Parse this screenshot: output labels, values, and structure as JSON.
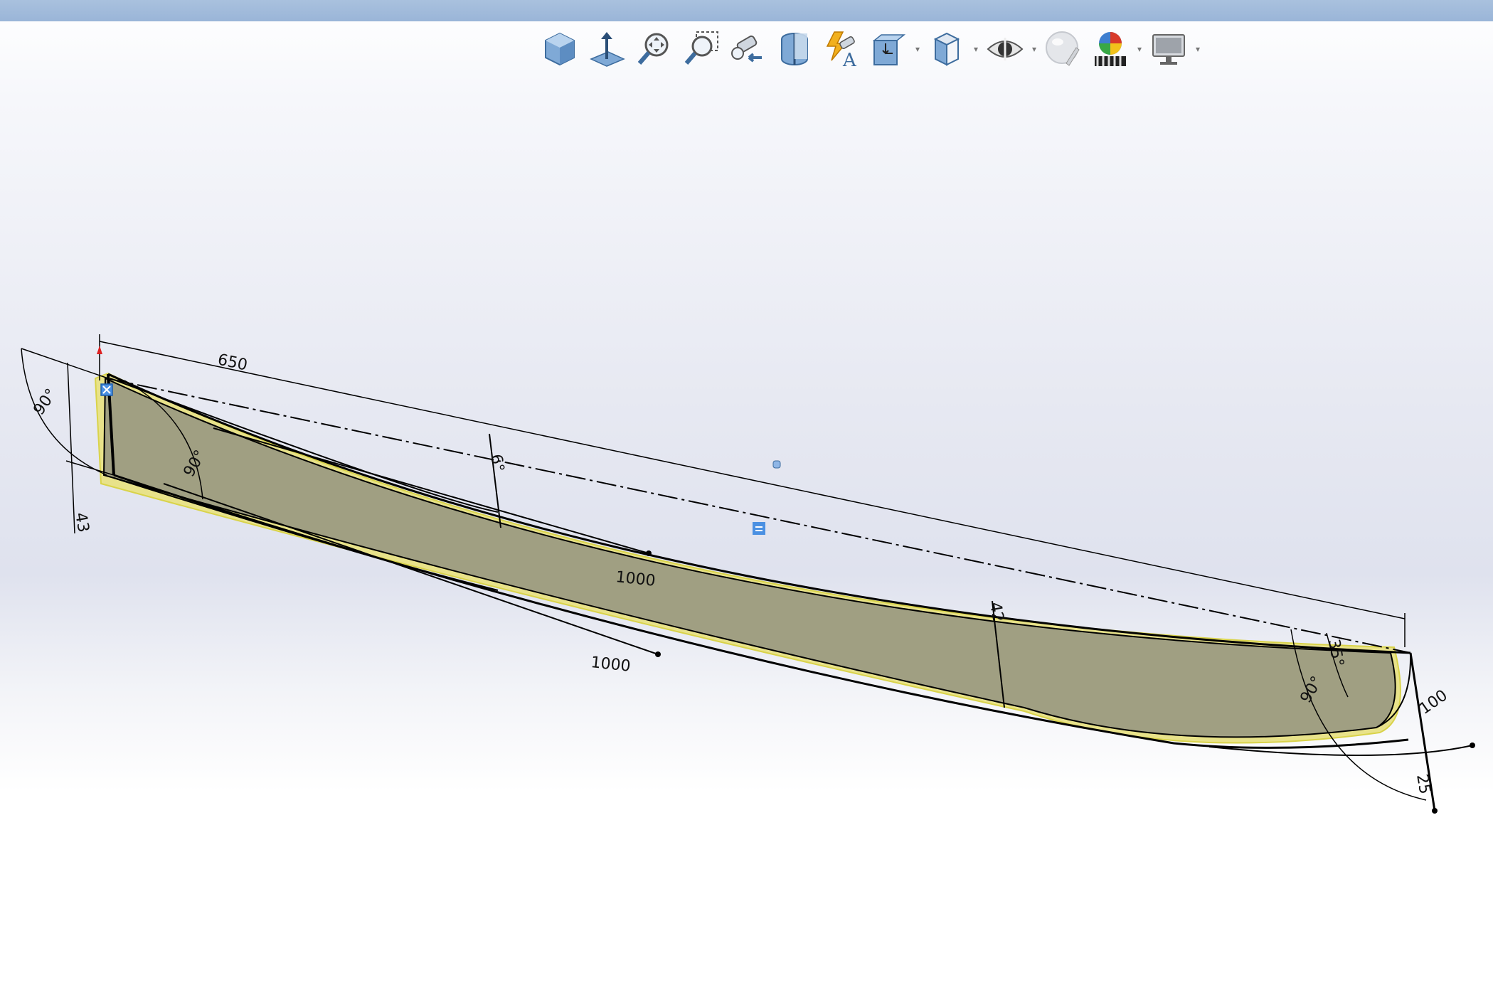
{
  "toolbar": {
    "buttons": [
      {
        "name": "view-orientation-icon"
      },
      {
        "name": "normal-to-icon"
      },
      {
        "name": "zoom-to-fit-icon"
      },
      {
        "name": "zoom-to-area-icon"
      },
      {
        "name": "previous-view-icon"
      },
      {
        "name": "section-view-icon"
      },
      {
        "name": "dynamic-annotation-views-icon"
      },
      {
        "name": "view-orientation-dropdown-icon"
      },
      {
        "name": "display-style-icon"
      },
      {
        "name": "hide-show-items-icon"
      },
      {
        "name": "edit-appearance-icon"
      },
      {
        "name": "apply-scene-icon"
      },
      {
        "name": "view-settings-icon"
      }
    ],
    "dropdown_glyph": "▾"
  },
  "dimensions": {
    "length_top": "650",
    "angle_left_outer": "90°",
    "angle_left_inner": "90°",
    "height_left": "43",
    "angle_mid": "6°",
    "radius_upper": "1000",
    "radius_lower": "1000",
    "depth_mid": "42",
    "angle_right_small": "35°",
    "angle_right": "90°",
    "length_right": "100",
    "length_right_bottom": "25"
  },
  "colors": {
    "part_fill": "#a09f82",
    "part_edge_highlight": "#e8e28a",
    "selection_blue": "#4a90e2",
    "topbar": "#a9c1de"
  }
}
